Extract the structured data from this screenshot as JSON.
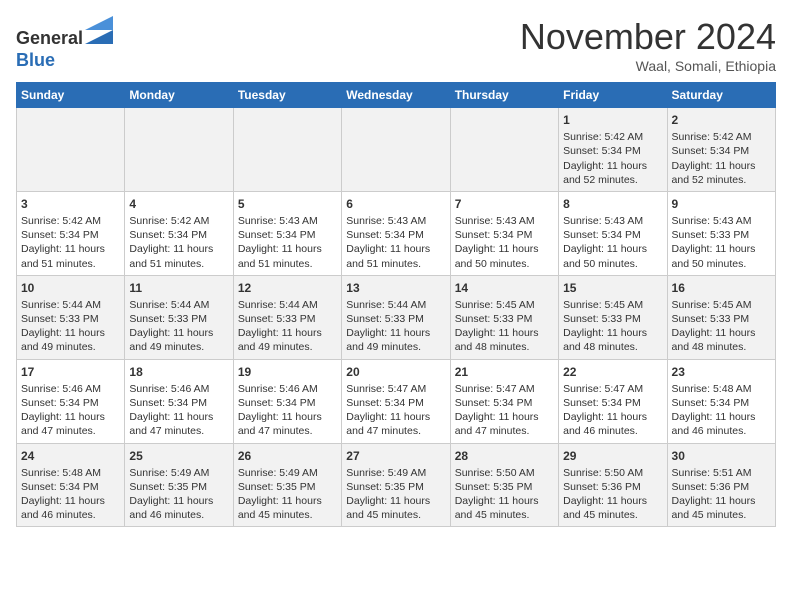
{
  "header": {
    "logo_line1": "General",
    "logo_line2": "Blue",
    "month_title": "November 2024",
    "location": "Waal, Somali, Ethiopia"
  },
  "days_of_week": [
    "Sunday",
    "Monday",
    "Tuesday",
    "Wednesday",
    "Thursday",
    "Friday",
    "Saturday"
  ],
  "weeks": [
    [
      {
        "day": "",
        "info": ""
      },
      {
        "day": "",
        "info": ""
      },
      {
        "day": "",
        "info": ""
      },
      {
        "day": "",
        "info": ""
      },
      {
        "day": "",
        "info": ""
      },
      {
        "day": "1",
        "info": "Sunrise: 5:42 AM\nSunset: 5:34 PM\nDaylight: 11 hours\nand 52 minutes."
      },
      {
        "day": "2",
        "info": "Sunrise: 5:42 AM\nSunset: 5:34 PM\nDaylight: 11 hours\nand 52 minutes."
      }
    ],
    [
      {
        "day": "3",
        "info": "Sunrise: 5:42 AM\nSunset: 5:34 PM\nDaylight: 11 hours\nand 51 minutes."
      },
      {
        "day": "4",
        "info": "Sunrise: 5:42 AM\nSunset: 5:34 PM\nDaylight: 11 hours\nand 51 minutes."
      },
      {
        "day": "5",
        "info": "Sunrise: 5:43 AM\nSunset: 5:34 PM\nDaylight: 11 hours\nand 51 minutes."
      },
      {
        "day": "6",
        "info": "Sunrise: 5:43 AM\nSunset: 5:34 PM\nDaylight: 11 hours\nand 51 minutes."
      },
      {
        "day": "7",
        "info": "Sunrise: 5:43 AM\nSunset: 5:34 PM\nDaylight: 11 hours\nand 50 minutes."
      },
      {
        "day": "8",
        "info": "Sunrise: 5:43 AM\nSunset: 5:34 PM\nDaylight: 11 hours\nand 50 minutes."
      },
      {
        "day": "9",
        "info": "Sunrise: 5:43 AM\nSunset: 5:33 PM\nDaylight: 11 hours\nand 50 minutes."
      }
    ],
    [
      {
        "day": "10",
        "info": "Sunrise: 5:44 AM\nSunset: 5:33 PM\nDaylight: 11 hours\nand 49 minutes."
      },
      {
        "day": "11",
        "info": "Sunrise: 5:44 AM\nSunset: 5:33 PM\nDaylight: 11 hours\nand 49 minutes."
      },
      {
        "day": "12",
        "info": "Sunrise: 5:44 AM\nSunset: 5:33 PM\nDaylight: 11 hours\nand 49 minutes."
      },
      {
        "day": "13",
        "info": "Sunrise: 5:44 AM\nSunset: 5:33 PM\nDaylight: 11 hours\nand 49 minutes."
      },
      {
        "day": "14",
        "info": "Sunrise: 5:45 AM\nSunset: 5:33 PM\nDaylight: 11 hours\nand 48 minutes."
      },
      {
        "day": "15",
        "info": "Sunrise: 5:45 AM\nSunset: 5:33 PM\nDaylight: 11 hours\nand 48 minutes."
      },
      {
        "day": "16",
        "info": "Sunrise: 5:45 AM\nSunset: 5:33 PM\nDaylight: 11 hours\nand 48 minutes."
      }
    ],
    [
      {
        "day": "17",
        "info": "Sunrise: 5:46 AM\nSunset: 5:34 PM\nDaylight: 11 hours\nand 47 minutes."
      },
      {
        "day": "18",
        "info": "Sunrise: 5:46 AM\nSunset: 5:34 PM\nDaylight: 11 hours\nand 47 minutes."
      },
      {
        "day": "19",
        "info": "Sunrise: 5:46 AM\nSunset: 5:34 PM\nDaylight: 11 hours\nand 47 minutes."
      },
      {
        "day": "20",
        "info": "Sunrise: 5:47 AM\nSunset: 5:34 PM\nDaylight: 11 hours\nand 47 minutes."
      },
      {
        "day": "21",
        "info": "Sunrise: 5:47 AM\nSunset: 5:34 PM\nDaylight: 11 hours\nand 47 minutes."
      },
      {
        "day": "22",
        "info": "Sunrise: 5:47 AM\nSunset: 5:34 PM\nDaylight: 11 hours\nand 46 minutes."
      },
      {
        "day": "23",
        "info": "Sunrise: 5:48 AM\nSunset: 5:34 PM\nDaylight: 11 hours\nand 46 minutes."
      }
    ],
    [
      {
        "day": "24",
        "info": "Sunrise: 5:48 AM\nSunset: 5:34 PM\nDaylight: 11 hours\nand 46 minutes."
      },
      {
        "day": "25",
        "info": "Sunrise: 5:49 AM\nSunset: 5:35 PM\nDaylight: 11 hours\nand 46 minutes."
      },
      {
        "day": "26",
        "info": "Sunrise: 5:49 AM\nSunset: 5:35 PM\nDaylight: 11 hours\nand 45 minutes."
      },
      {
        "day": "27",
        "info": "Sunrise: 5:49 AM\nSunset: 5:35 PM\nDaylight: 11 hours\nand 45 minutes."
      },
      {
        "day": "28",
        "info": "Sunrise: 5:50 AM\nSunset: 5:35 PM\nDaylight: 11 hours\nand 45 minutes."
      },
      {
        "day": "29",
        "info": "Sunrise: 5:50 AM\nSunset: 5:36 PM\nDaylight: 11 hours\nand 45 minutes."
      },
      {
        "day": "30",
        "info": "Sunrise: 5:51 AM\nSunset: 5:36 PM\nDaylight: 11 hours\nand 45 minutes."
      }
    ]
  ]
}
